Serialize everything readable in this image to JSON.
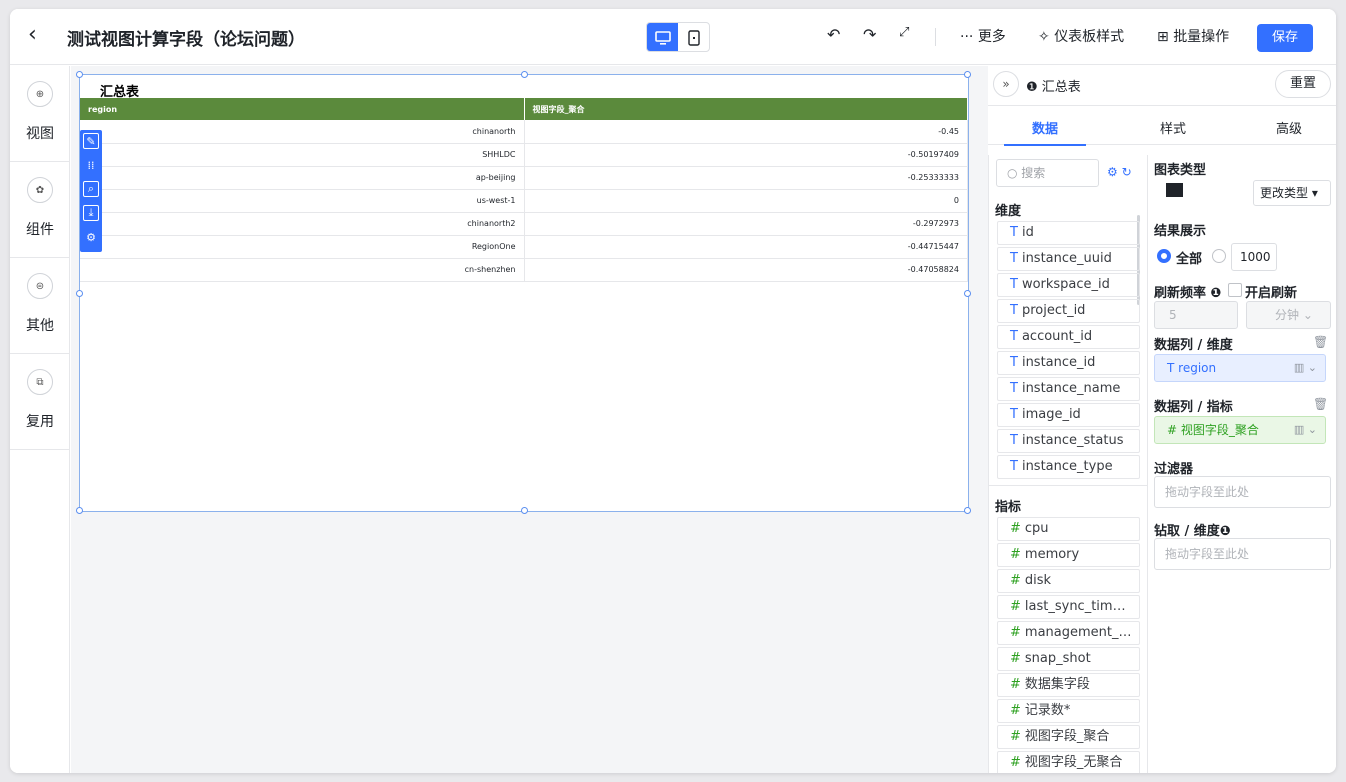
{
  "header": {
    "title": "测试视图计算字段（论坛问题）",
    "more": "更多",
    "dashboard_style": "仪表板样式",
    "batch": "批量操作",
    "save": "保存"
  },
  "leftbar": {
    "items": [
      {
        "label": "视图"
      },
      {
        "label": "组件"
      },
      {
        "label": "其他"
      },
      {
        "label": "复用"
      }
    ]
  },
  "chart": {
    "title": "汇总表",
    "columns": [
      "region",
      "视图字段_聚合"
    ],
    "rows": [
      {
        "region": "chinanorth",
        "value": "-0.45"
      },
      {
        "region": "SHHLDC",
        "value": "-0.50197409"
      },
      {
        "region": "ap-beijing",
        "value": "-0.25333333"
      },
      {
        "region": "us-west-1",
        "value": "0"
      },
      {
        "region": "chinanorth2",
        "value": "-0.2972973"
      },
      {
        "region": "RegionOne",
        "value": "-0.44715447"
      },
      {
        "region": "cn-shenzhen",
        "value": "-0.47058824"
      }
    ]
  },
  "fields": {
    "search_placeholder": "搜索",
    "dimensions_label": "维度",
    "dimensions": [
      "id",
      "instance_uuid",
      "workspace_id",
      "project_id",
      "account_id",
      "instance_id",
      "instance_name",
      "image_id",
      "instance_status",
      "instance_type"
    ],
    "metrics_label": "指标",
    "metrics": [
      "cpu",
      "memory",
      "disk",
      "last_sync_tim…",
      "management_…",
      "snap_shot",
      "数据集字段",
      "记录数*",
      "视图字段_聚合",
      "视图字段_无聚合"
    ]
  },
  "right": {
    "panel_title": "汇总表",
    "reset": "重置",
    "tabs": [
      "数据",
      "样式",
      "高级"
    ],
    "chart_type_label": "图表类型",
    "change_type": "更改类型",
    "result_label": "结果展示",
    "all": "全部",
    "limit_value": "1000",
    "refresh_label": "刷新频率",
    "enable_refresh": "开启刷新",
    "refresh_value": "5",
    "refresh_unit": "分钟",
    "dim_col_label": "数据列 / 维度",
    "dim_col_value": "region",
    "met_col_label": "数据列 / 指标",
    "met_col_value": "视图字段_聚合",
    "filter_label": "过滤器",
    "filter_placeholder": "拖动字段至此处",
    "drill_label": "钻取 / 维度",
    "drill_placeholder": "拖动字段至此处"
  }
}
